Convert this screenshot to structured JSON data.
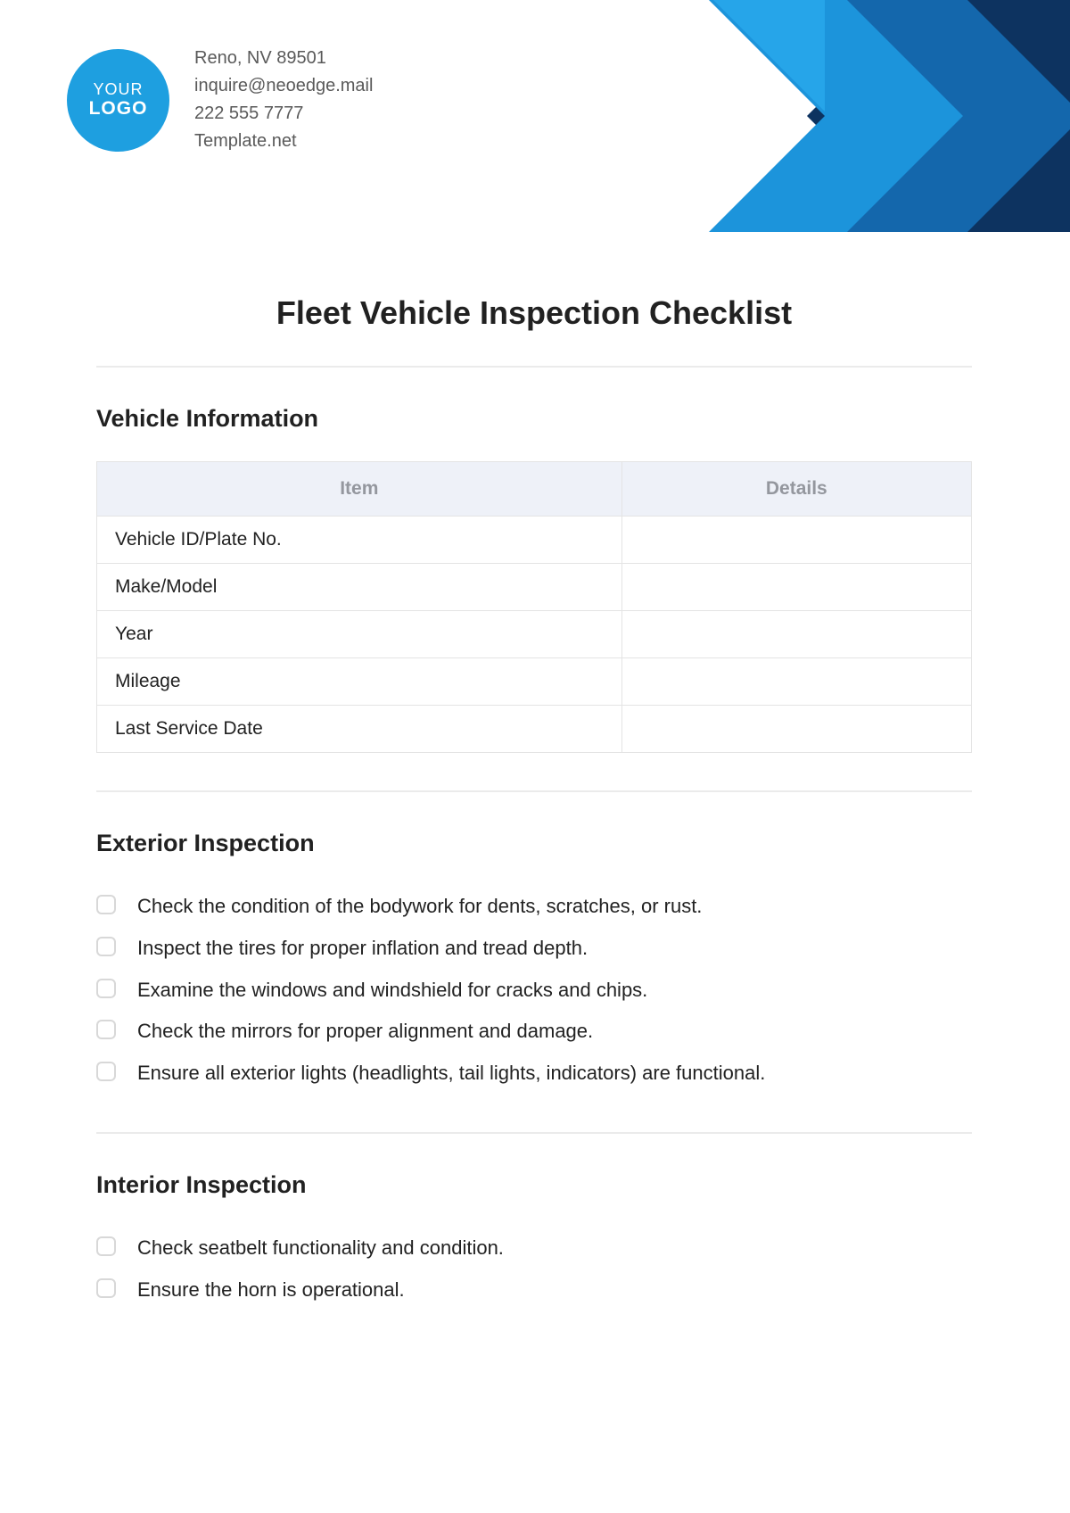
{
  "logo": {
    "line1": "YOUR",
    "line2": "LOGO"
  },
  "contact": {
    "address": "Reno, NV 89501",
    "email": "inquire@neoedge.mail",
    "phone": "222 555 7777",
    "site": "Template.net"
  },
  "title": "Fleet Vehicle Inspection Checklist",
  "sections": {
    "vehicleInfo": {
      "heading": "Vehicle Information",
      "columns": {
        "item": "Item",
        "details": "Details"
      },
      "rows": [
        {
          "item": "Vehicle ID/Plate No.",
          "details": ""
        },
        {
          "item": "Make/Model",
          "details": ""
        },
        {
          "item": "Year",
          "details": ""
        },
        {
          "item": "Mileage",
          "details": ""
        },
        {
          "item": "Last Service Date",
          "details": ""
        }
      ]
    },
    "exterior": {
      "heading": "Exterior Inspection",
      "items": [
        "Check the condition of the bodywork for dents, scratches, or rust.",
        "Inspect the tires for proper inflation and tread depth.",
        "Examine the windows and windshield for cracks and chips.",
        "Check the mirrors for proper alignment and damage.",
        "Ensure all exterior lights (headlights, tail lights, indicators) are functional."
      ]
    },
    "interior": {
      "heading": "Interior Inspection",
      "items": [
        "Check seatbelt functionality and condition.",
        "Ensure the horn is operational."
      ]
    }
  }
}
